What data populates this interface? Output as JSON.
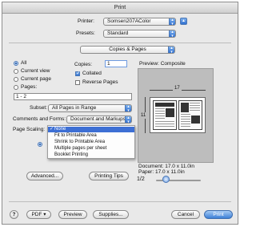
{
  "window": {
    "title": "Print"
  },
  "printer": {
    "label": "Printer:",
    "value": "Somsen207AColor"
  },
  "presets": {
    "label": "Presets:",
    "value": "Standard"
  },
  "panel": {
    "value": "Copies & Pages"
  },
  "pages": {
    "options": [
      "All",
      "Current view",
      "Current page",
      "Pages:"
    ],
    "selected": "All",
    "range_value": "1 - 2"
  },
  "copies": {
    "label": "Copies:",
    "value": "1"
  },
  "collated": {
    "label": "Collated",
    "checked": true
  },
  "reverse": {
    "label": "Reverse Pages",
    "checked": false
  },
  "subset": {
    "label": "Subset:",
    "value": "All Pages in Range"
  },
  "comments": {
    "label": "Comments and Forms:",
    "value": "Document and Markups"
  },
  "page_scaling": {
    "label": "Page Scaling:",
    "selected": "None",
    "options": [
      "None",
      "Fit to Printable Area",
      "Shrink to Printable Area",
      "Multiple pages per sheet",
      "Booklet Printing"
    ]
  },
  "preview": {
    "label": "Preview: Composite",
    "width_dim": "17",
    "height_dim": "11",
    "document_size": "Document: 17.0 x 11.0in",
    "paper_size": "Paper: 17.0 x 11.0in",
    "page_indicator": "1/2"
  },
  "buttons": {
    "advanced": "Advanced...",
    "printing_tips": "Printing Tips",
    "help": "?",
    "pdf": "PDF ▾",
    "preview": "Preview",
    "supplies": "Supplies...",
    "cancel": "Cancel",
    "print": "Print"
  }
}
